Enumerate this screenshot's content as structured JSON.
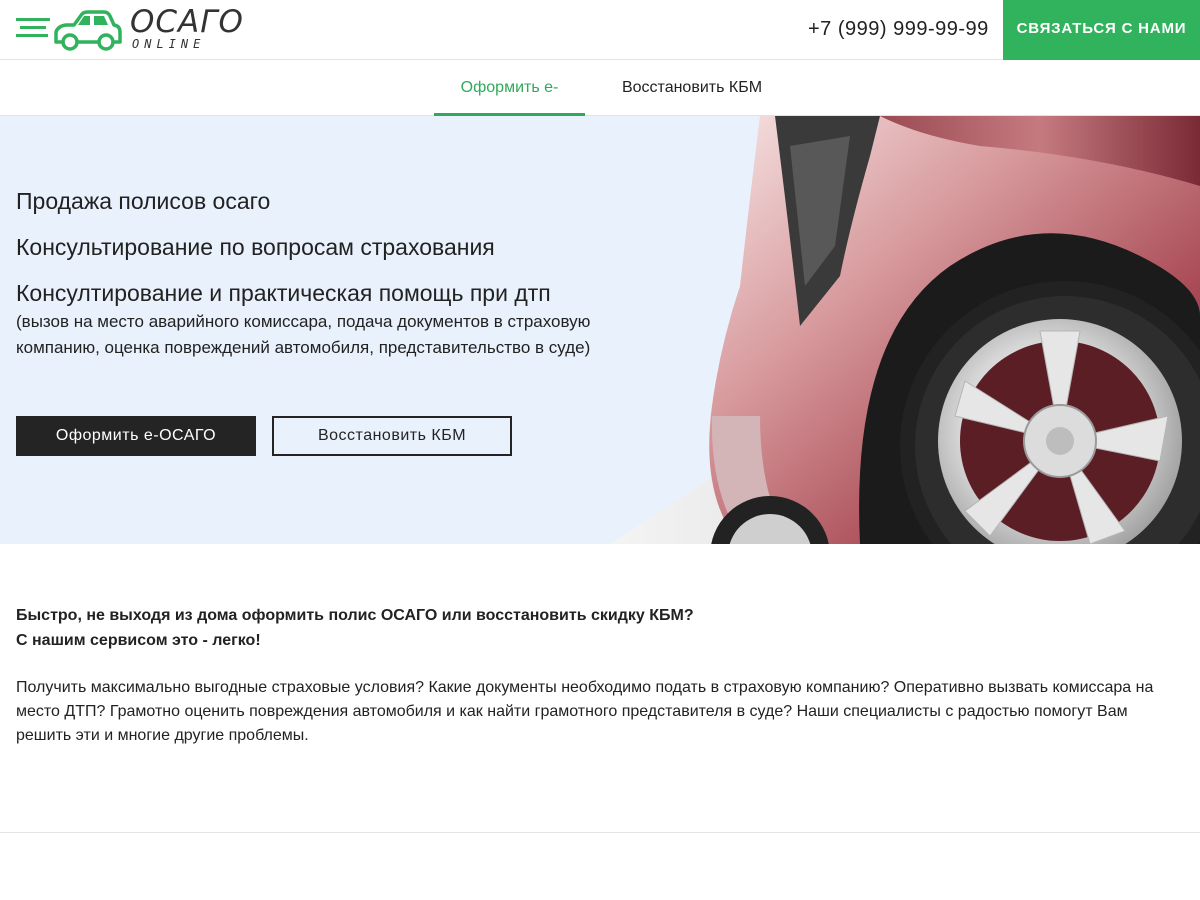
{
  "header": {
    "logo_title": "ОСАГО",
    "logo_sub": "ONLINE",
    "phone": "+7 (999) 999-99-99",
    "contact_label": "Связаться с нами"
  },
  "nav": {
    "tabs": [
      {
        "label": "Оформить е-ОСАГО",
        "active": true
      },
      {
        "label": "Восстановить КБМ",
        "active": false
      }
    ]
  },
  "hero": {
    "lines": [
      "Продажа полисов осаго",
      "Консультирование по вопросам страхования",
      "Консултирование и практическая помощь при дтп"
    ],
    "note": "(вызов на место аварийного комиссара, подача документов в страховую компанию, оценка повреждений автомобиля, представительство в суде)",
    "primary_button": "Оформить е-ОСАГО",
    "secondary_button": "Восстановить КБМ"
  },
  "info": {
    "bold_line1": "Быстро, не выходя из дома оформить полис ОСАГО или восстановить скидку КБМ?",
    "bold_line2": "С нашим сервисом это - легко!",
    "text": "Получить максимально выгодные страховые условия? Какие документы необходимо подать в страховую компанию? Оперативно вызвать комиссара на место ДТП? Грамотно оценить  повреждения автомобиля и как найти грамотного представителя в суде? Наши специалисты с радостью помогут Вам решить эти и многие другие проблемы."
  },
  "colors": {
    "accent": "#31b35e",
    "hero_bg": "#e9f1fc",
    "dark_button": "#242424"
  },
  "icons": {
    "logo": "car-logo-icon",
    "hero_image": "red-car-wheel-image"
  }
}
